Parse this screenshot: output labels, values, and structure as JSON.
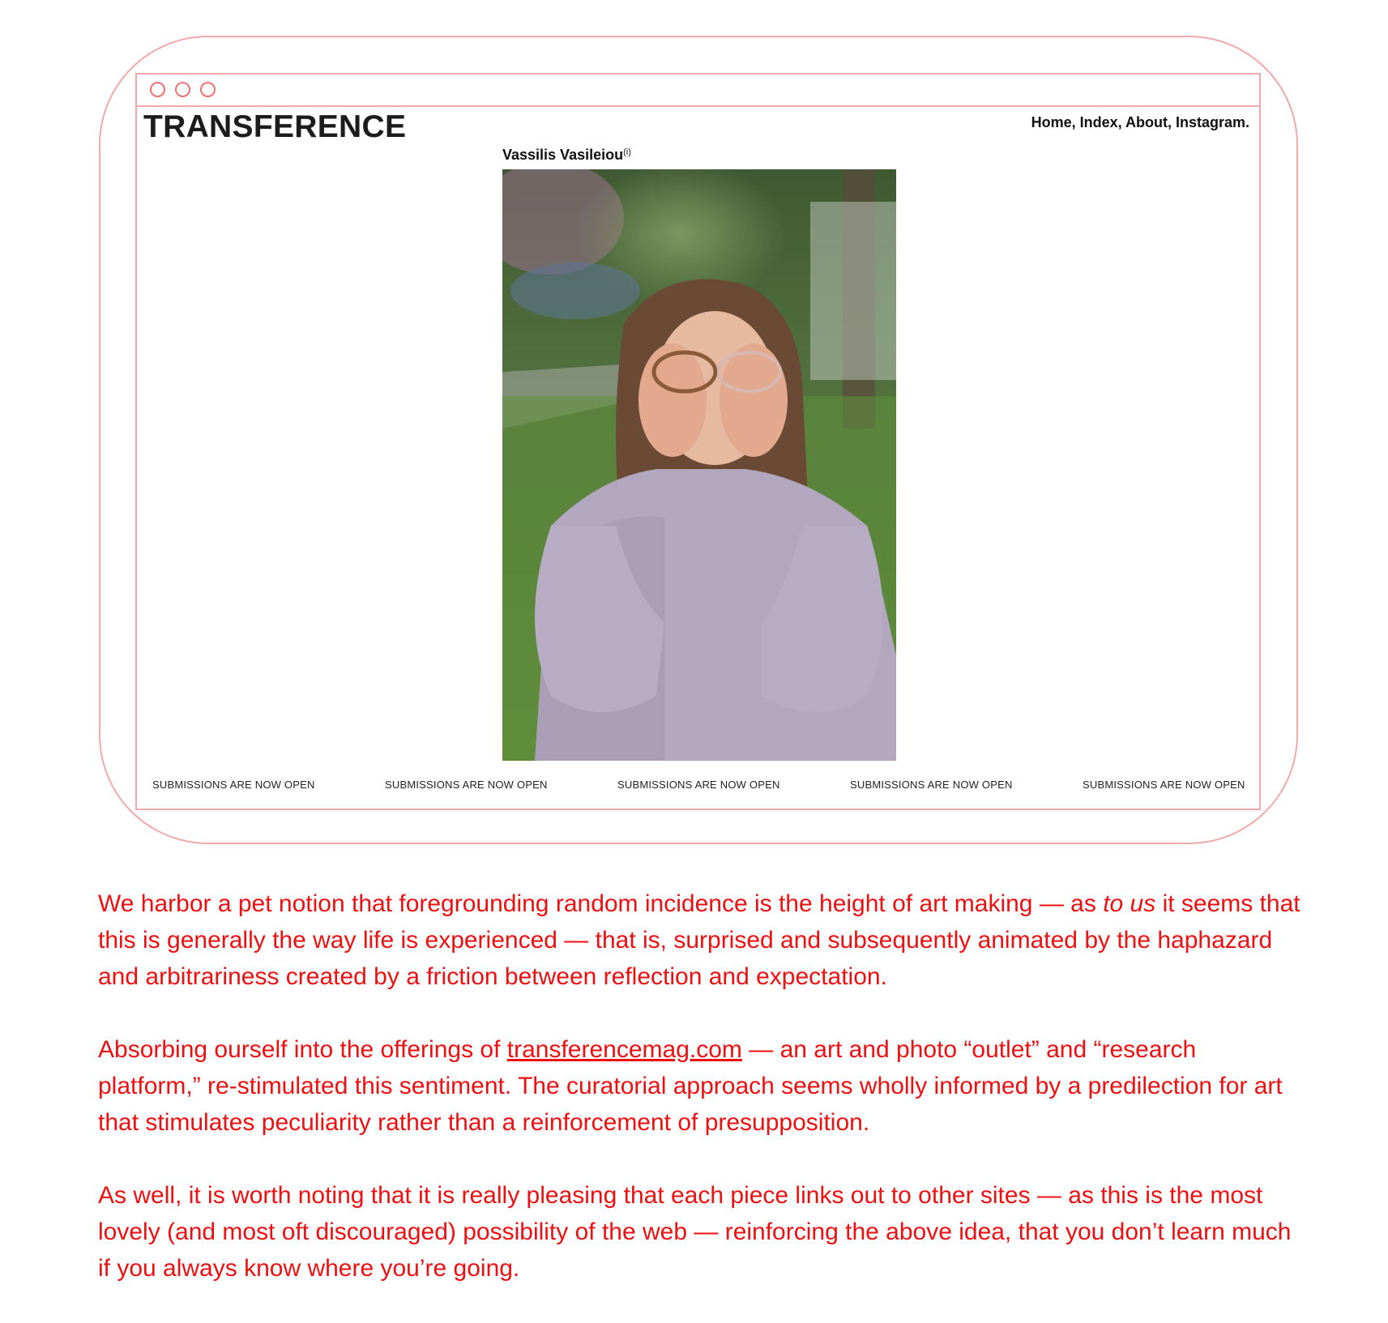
{
  "browser": {
    "logo": "TRANSFERENCE",
    "nav": [
      "Home,",
      "Index,",
      "About,",
      "Instagram."
    ],
    "artist": {
      "name": "Vassilis Vasileiou",
      "marker": "(i)"
    },
    "ticker": [
      "SUBMISSIONS ARE NOW OPEN",
      "SUBMISSIONS ARE NOW OPEN",
      "SUBMISSIONS ARE NOW OPEN",
      "SUBMISSIONS ARE NOW OPEN",
      "SUBMISSIONS ARE NOW OPEN"
    ]
  },
  "article": {
    "p1": {
      "before": "We harbor a pet notion that foregrounding random incidence is the height of art making — as ",
      "emph": "to us",
      "after": " it seems that this is generally the way life is experienced — that is, surprised and subsequently animated by the haphazard and arbitrariness created by a friction between reflection and expectation."
    },
    "p2": {
      "before": "Absorbing ourself into the offerings of ",
      "link": "transferencemag.com",
      "after": " — an art and photo “outlet” and “research platform,” re-stimulated this sentiment. The curatorial approach seems wholly informed by a predilection for art that stimulates peculiarity rather than a reinforcement of presupposition."
    },
    "p3": "As well, it is worth noting that it is really pleasing that each piece links out to other sites — as this is the most lovely (and most oft discouraged) possibility of the web — reinforcing the above idea, that you don’t learn much if you always know where you’re going."
  },
  "colors": {
    "frame": "#f2a9a9",
    "text_red": "#ee1010"
  }
}
